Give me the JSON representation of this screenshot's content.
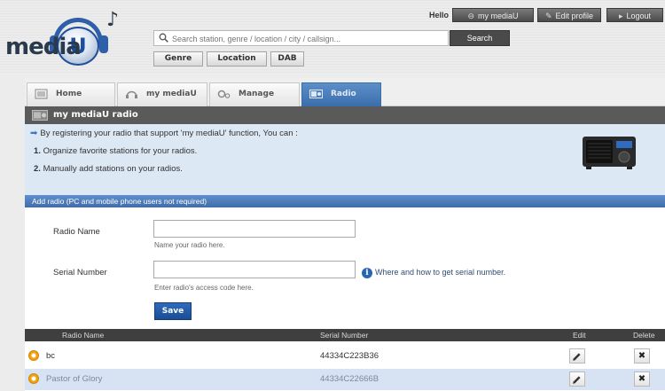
{
  "header": {
    "logo_text": "media",
    "logo_u": "U",
    "search": {
      "placeholder": "Search station, genre / location / city / callsign...",
      "button_label": "Search"
    },
    "filters": [
      "Genre",
      "Location",
      "DAB"
    ],
    "hello": "Hello",
    "top_buttons": [
      {
        "label": "my mediaU",
        "icon": "headphones-icon"
      },
      {
        "label": "Edit profile",
        "icon": "pencil-icon"
      },
      {
        "label": "Logout",
        "icon": "logout-icon"
      }
    ]
  },
  "tabs": [
    {
      "label": "Home",
      "icon": "home-icon",
      "active": false
    },
    {
      "label": "my mediaU",
      "icon": "headphones-icon",
      "active": false
    },
    {
      "label": "Manage",
      "icon": "gears-icon",
      "active": false
    },
    {
      "label": "Radio",
      "icon": "radio-icon",
      "active": true
    }
  ],
  "section": {
    "title": "my mediaU radio"
  },
  "info": {
    "intro": "By registering your radio that support 'my mediaU' function, You can :",
    "items": [
      {
        "num": "1.",
        "text": "Organize favorite stations for your radios."
      },
      {
        "num": "2.",
        "text": "Manually add stations on your radios."
      }
    ]
  },
  "add_bar": {
    "label": "Add radio (PC and mobile phone users not required)"
  },
  "form": {
    "radio_name": {
      "label": "Radio Name",
      "value": "",
      "hint": "Name your radio here."
    },
    "serial_number": {
      "label": "Serial Number",
      "value": "",
      "hint": "Enter radio's access code here."
    },
    "help_text": "Where and how to get serial number.",
    "save_label": "Save"
  },
  "table": {
    "columns": [
      "Radio Name",
      "Serial Number",
      "Edit",
      "Delete"
    ],
    "rows": [
      {
        "name": "bc",
        "serial": "44334C223B36"
      },
      {
        "name": "Pastor of Glory",
        "serial": "44334C22666B"
      }
    ]
  },
  "colors": {
    "active_tab": "#3a6eab",
    "info_background": "#dde8f5",
    "table_header": "#3f3f3f",
    "bullet": "#f1a20e"
  }
}
